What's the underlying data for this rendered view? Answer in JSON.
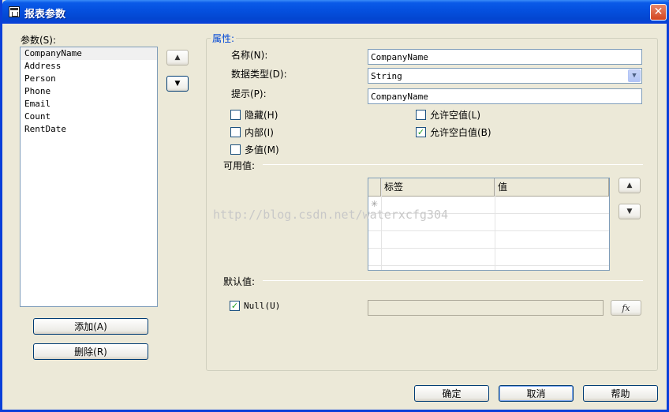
{
  "window": {
    "title": "报表参数",
    "close": "✕"
  },
  "params": {
    "label": "参数(S):",
    "items": [
      "CompanyName",
      "Address",
      "Person",
      "Phone",
      "Email",
      "Count",
      "RentDate"
    ],
    "selected": 0,
    "add_label": "添加(A)",
    "delete_label": "删除(R)"
  },
  "properties": {
    "group_label": "属性:",
    "name_label": "名称(N):",
    "name_value": "CompanyName",
    "type_label": "数据类型(D):",
    "type_value": "String",
    "prompt_label": "提示(P):",
    "prompt_value": "CompanyName",
    "hidden_label": "隐藏(H)",
    "internal_label": "内部(I)",
    "multi_label": "多值(M)",
    "allow_null_label": "允许空值(L)",
    "allow_blank_label": "允许空白值(B)",
    "allow_blank_checked": true,
    "available_label": "可用值:",
    "grid_col_label": "标签",
    "grid_col_value": "值",
    "new_row_marker": "✳",
    "default_label": "默认值:",
    "null_label": "Null(U)",
    "null_checked": true,
    "fx_label": "fx"
  },
  "footer": {
    "ok": "确定",
    "cancel": "取消",
    "help": "帮助"
  },
  "watermark": "http://blog.csdn.net/waterxcfg304",
  "icons": {
    "up": "▲",
    "down": "▼",
    "combo": "▼",
    "check": "✓"
  }
}
